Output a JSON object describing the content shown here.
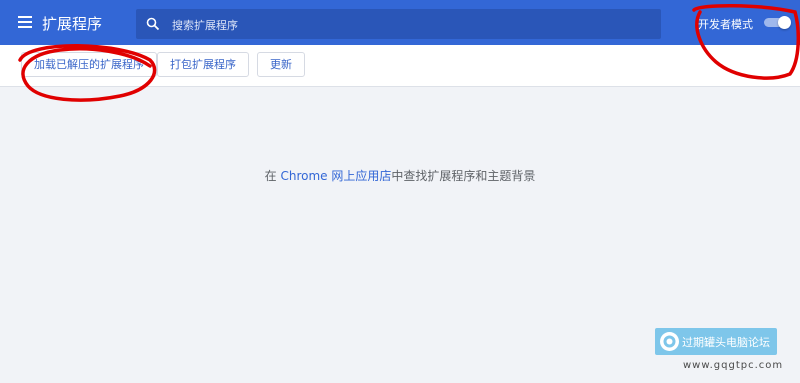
{
  "header": {
    "title": "扩展程序",
    "search_placeholder": "搜索扩展程序",
    "dev_mode_label": "开发者模式",
    "dev_mode_on": true
  },
  "toolbar": {
    "load_unpacked": "加载已解压的扩展程序",
    "pack_extension": "打包扩展程序",
    "update": "更新"
  },
  "main": {
    "empty_prefix": "在 ",
    "empty_link": "Chrome 网上应用店",
    "empty_suffix": "中查找扩展程序和主题背景"
  },
  "watermark": {
    "text": "过期罐头电脑论坛",
    "url": "www.gqgtpc.com"
  },
  "colors": {
    "header_bg": "#3367d6",
    "search_bg": "#2a56b8",
    "accent": "#3367d6",
    "annotation": "#e00000"
  }
}
